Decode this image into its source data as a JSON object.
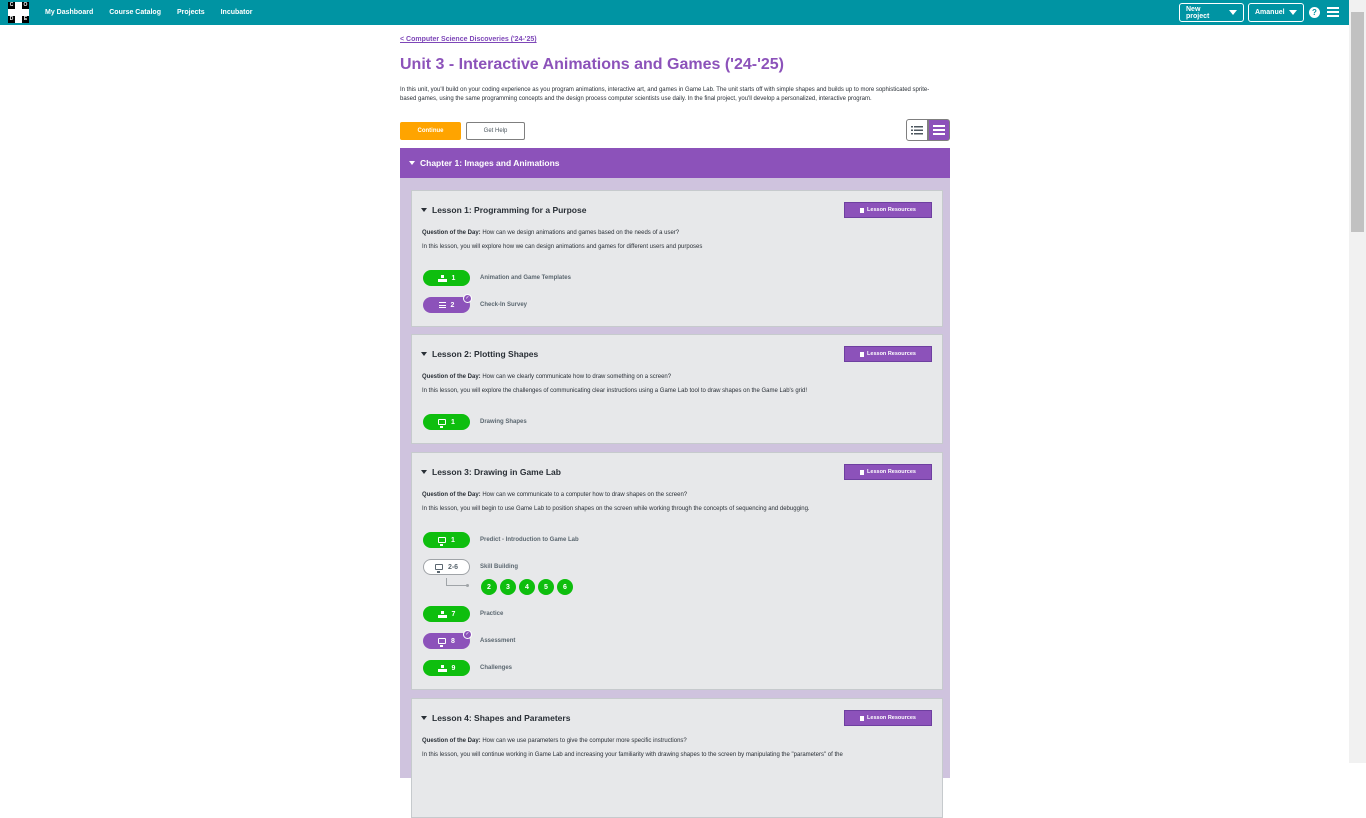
{
  "header": {
    "logo_letters": [
      "C",
      "O",
      "D",
      "E"
    ],
    "nav": [
      "My Dashboard",
      "Course Catalog",
      "Projects",
      "Incubator"
    ],
    "new_project": "New project",
    "user": "Amanuel",
    "help": "?"
  },
  "breadcrumb": "< Computer Science Discoveries ('24-'25)",
  "title": "Unit 3 - Interactive Animations and Games ('24-'25)",
  "description": "In this unit, you'll build on your coding experience as you program animations, interactive art, and games in Game Lab. The unit starts off with simple shapes and builds up to more sophisticated sprite-based games, using the same programming concepts and the design process computer scientists use daily. In the final project, you'll develop a personalized, interactive program.",
  "buttons": {
    "continue": "Continue",
    "get_help": "Get Help"
  },
  "chapter": {
    "title": "Chapter 1: Images and Animations"
  },
  "colors": {
    "header": "#0094a3",
    "purple": "#8c52ba",
    "green": "#0ebe0e",
    "orange": "#ffa400"
  },
  "resources_label": "Lesson Resources",
  "lessons": [
    {
      "title": "Lesson 1: Programming for a Purpose",
      "qod_label": "Question of the Day:",
      "qod": "How can we design animations and games based on the needs of a user?",
      "overview": "In this lesson, you will explore how we can design animations and games for different users and purposes",
      "activities": [
        {
          "num": "1",
          "label": "Animation and Game Templates",
          "icon": "tree-icon",
          "style": "green"
        },
        {
          "num": "2",
          "label": "Check-In Survey",
          "icon": "list-icon",
          "style": "purple",
          "assessment": true
        }
      ]
    },
    {
      "title": "Lesson 2: Plotting Shapes",
      "qod_label": "Question of the Day:",
      "qod": "How can we clearly communicate how to draw something on a screen?",
      "overview": "In this lesson, you will explore the challenges of communicating clear instructions using a Game Lab tool to draw shapes on the Game Lab's grid!",
      "activities": [
        {
          "num": "1",
          "label": "Drawing Shapes",
          "icon": "monitor-icon",
          "style": "green"
        }
      ]
    },
    {
      "title": "Lesson 3: Drawing in Game Lab",
      "qod_label": "Question of the Day:",
      "qod": "How can we communicate to a computer how to draw shapes on the screen?",
      "overview": "In this lesson, you will begin to use Game Lab to position shapes on the screen while working through the concepts of sequencing and debugging.",
      "activities": [
        {
          "num": "1",
          "label": "Predict - Introduction to Game Lab",
          "icon": "monitor-icon",
          "style": "green"
        },
        {
          "num": "2-6",
          "label": "Skill Building",
          "icon": "monitor-icon",
          "style": "outline",
          "sublevels": [
            "2",
            "3",
            "4",
            "5",
            "6"
          ]
        },
        {
          "num": "7",
          "label": "Practice",
          "icon": "tree-icon",
          "style": "green"
        },
        {
          "num": "8",
          "label": "Assessment",
          "icon": "monitor-icon",
          "style": "purple",
          "assessment": true
        },
        {
          "num": "9",
          "label": "Challenges",
          "icon": "tree-icon",
          "style": "green"
        }
      ]
    },
    {
      "title": "Lesson 4: Shapes and Parameters",
      "qod_label": "Question of the Day:",
      "qod": "How can we use parameters to give the computer more specific instructions?",
      "overview": "In this lesson, you will continue working in Game Lab and increasing your familiarity with drawing shapes to the screen by manipulating the \"parameters\" of the"
    }
  ]
}
